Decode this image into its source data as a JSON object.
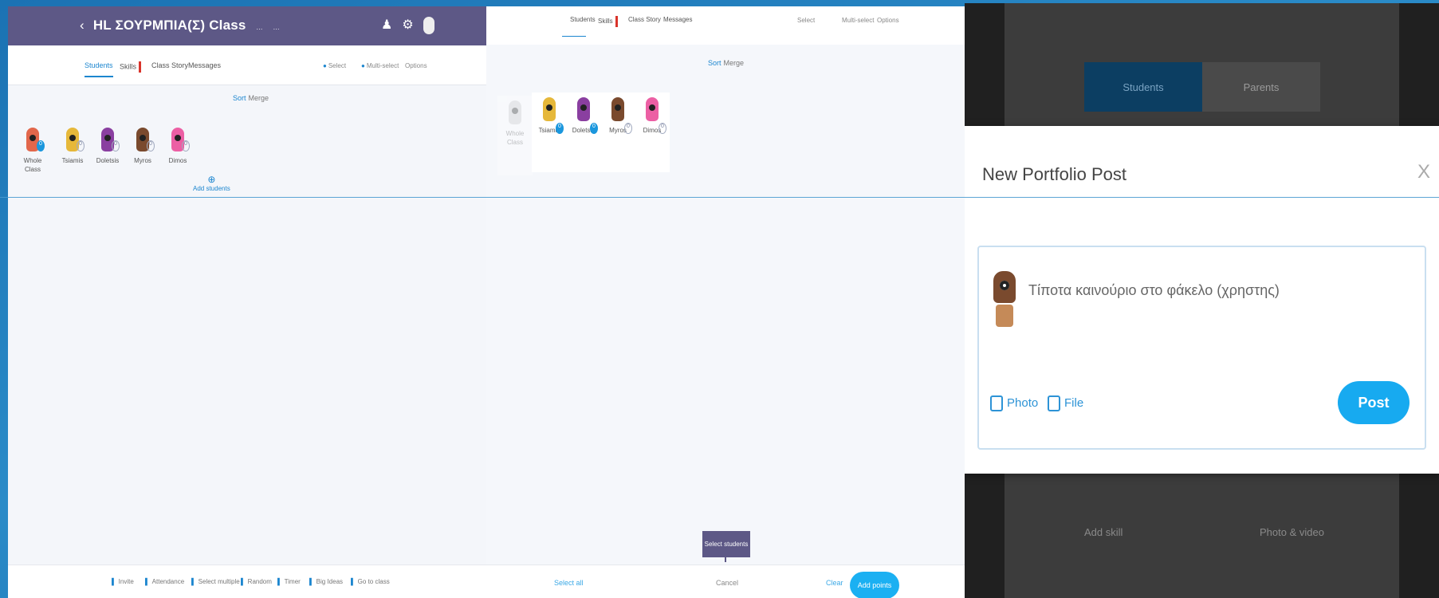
{
  "panel1": {
    "header": {
      "title": "HL ΣΟΥΡΜΠΙΑ(Σ) Class",
      "back_icon": "chevron-left-icon",
      "sub1": "...",
      "sub2": "..."
    },
    "tabs": [
      "Students",
      "Skills",
      "Class Story",
      "Messages"
    ],
    "tools": [
      "Select",
      "Multi-select",
      "Options"
    ],
    "sort": {
      "active": "Sort",
      "other": "Merge"
    },
    "students": [
      {
        "name": "Whole Class",
        "points": "0",
        "color": "#e2674b"
      },
      {
        "name": "Tsiamis",
        "points": "0",
        "color": "#e6b83a"
      },
      {
        "name": "Doletsis",
        "points": "0",
        "color": "#8a3fa0"
      },
      {
        "name": "Myros",
        "points": "0",
        "color": "#7a4a2e"
      },
      {
        "name": "Dimos",
        "points": "0",
        "color": "#ec5fa4"
      }
    ],
    "add_student": "Add students",
    "bottom": [
      "Invite",
      "Attendance",
      "Select multiple",
      "Random",
      "Timer",
      "Big Ideas",
      "Go to class"
    ]
  },
  "panel2": {
    "tabs": [
      "Students",
      "Skills",
      "Class Story",
      "Messages"
    ],
    "tools": [
      "Select",
      "Multi-select",
      "Options"
    ],
    "sort": {
      "active": "Sort",
      "other": "Merge"
    },
    "students": [
      {
        "name": "Whole Class",
        "points": "0",
        "color": "#cccccc",
        "faded": true
      },
      {
        "name": "Tsiamis",
        "points": "0",
        "color": "#e6b83a"
      },
      {
        "name": "Doletsis",
        "points": "0",
        "color": "#8a3fa0"
      },
      {
        "name": "Myros",
        "points": "0",
        "color": "#7a4a2e"
      },
      {
        "name": "Dimos",
        "points": "0",
        "color": "#ec5fa4"
      }
    ],
    "tooltip": "Select students",
    "bottom": {
      "left": "Select all",
      "center": "Cancel",
      "right_link": "Clear",
      "button": "Add points"
    }
  },
  "panel3": {
    "segment": [
      "Students",
      "Parents"
    ],
    "modal": {
      "title": "New Portfolio Post",
      "close": "X",
      "placeholder": "Τίποτα καινούριο στο φάκελο (χρηστης)",
      "photo": "Photo",
      "file": "File",
      "post": "Post"
    },
    "dim_buttons": [
      "Add skill",
      "Photo & video"
    ]
  }
}
